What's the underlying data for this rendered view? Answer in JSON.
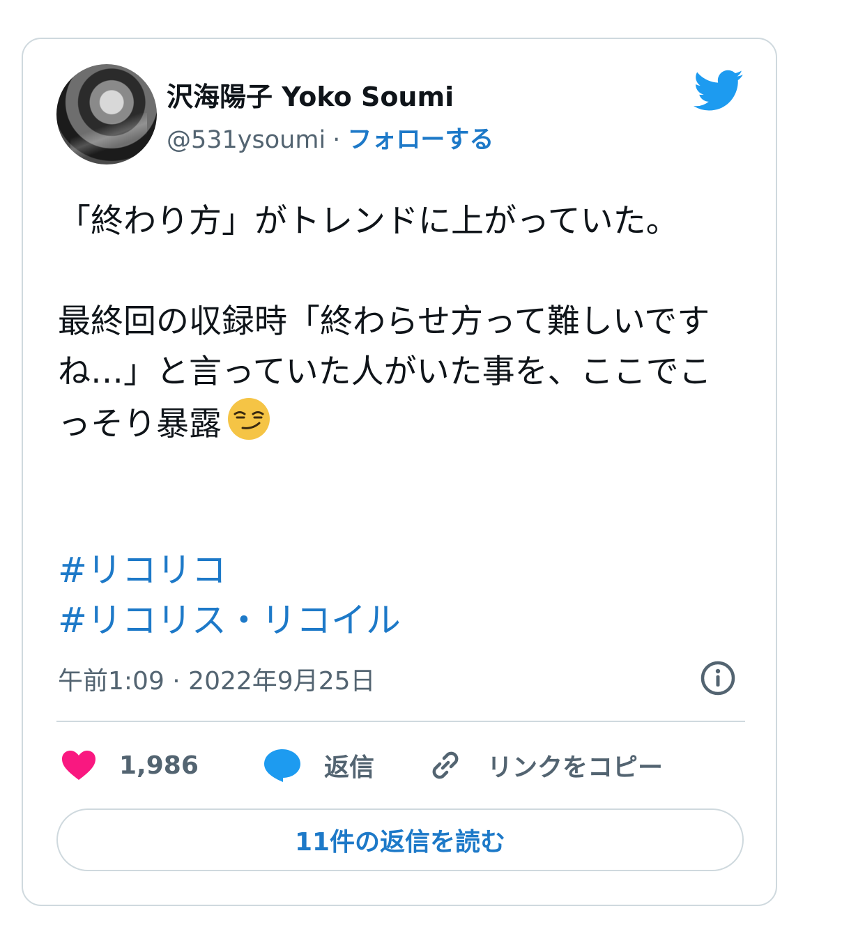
{
  "author": {
    "display_name": "沢海陽子 Yoko Soumi",
    "handle": "@531ysoumi",
    "separator": "·",
    "follow_label": "フォローする"
  },
  "tweet": {
    "lines": [
      "「終わり方」がトレンドに上がっていた。",
      "最終回の収録時「終わらせ方って難しいですね…」と言っていた人がいた事を、ここでこっそり暴露"
    ],
    "emoji": "smirking-face",
    "hashtags": [
      "#リコリコ",
      "#リコリス・リコイル"
    ],
    "timestamp": "午前1:09 · 2022年9月25日"
  },
  "actions": {
    "like_count": "1,986",
    "reply_label": "返信",
    "copy_link_label": "リンクをコピー"
  },
  "read_replies_label": "11件の返信を読む",
  "colors": {
    "accent": "#1d79c8",
    "twitter_blue": "#1d9bf0",
    "like_pink": "#f91880",
    "text": "#0f1419",
    "muted": "#536471",
    "border": "#cfd9de"
  }
}
